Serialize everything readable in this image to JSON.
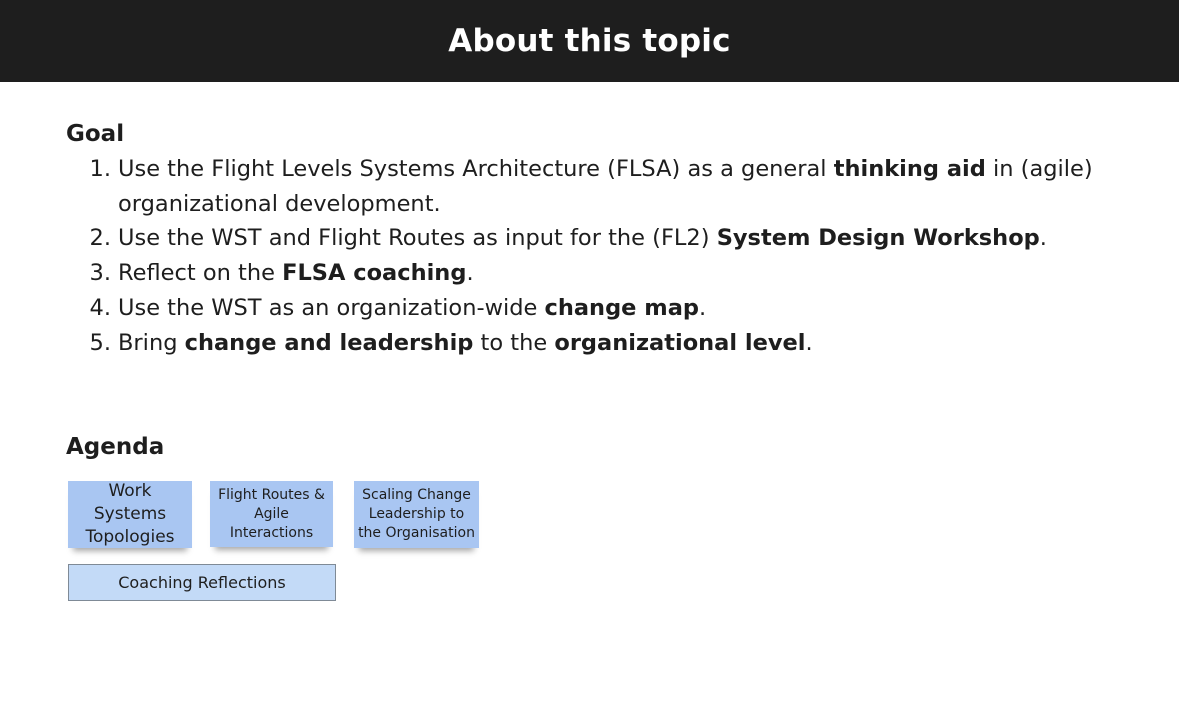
{
  "header": {
    "title": "About this topic"
  },
  "goal": {
    "heading": "Goal",
    "items": [
      {
        "number": "1.",
        "parts": [
          {
            "text": "Use the Flight Levels Systems Architecture (FLSA) as a general ",
            "bold": false
          },
          {
            "text": "thinking aid",
            "bold": true
          },
          {
            "text": " in (agile) organizational development.",
            "bold": false
          }
        ]
      },
      {
        "number": "2.",
        "parts": [
          {
            "text": "Use the WST and Flight Routes as input for the (FL2) ",
            "bold": false
          },
          {
            "text": "System Design Workshop",
            "bold": true
          },
          {
            "text": ".",
            "bold": false
          }
        ]
      },
      {
        "number": "3.",
        "parts": [
          {
            "text": "Reflect on the ",
            "bold": false
          },
          {
            "text": "FLSA coaching",
            "bold": true
          },
          {
            "text": ".",
            "bold": false
          }
        ]
      },
      {
        "number": "4.",
        "parts": [
          {
            "text": "Use the WST as an organization-wide ",
            "bold": false
          },
          {
            "text": "change map",
            "bold": true
          },
          {
            "text": ".",
            "bold": false
          }
        ]
      },
      {
        "number": "5.",
        "parts": [
          {
            "text": "Bring ",
            "bold": false
          },
          {
            "text": "change and leadership",
            "bold": true
          },
          {
            "text": " to the ",
            "bold": false
          },
          {
            "text": "organizational level",
            "bold": true
          },
          {
            "text": ".",
            "bold": false
          }
        ]
      }
    ]
  },
  "agenda": {
    "heading": "Agenda",
    "stickies": [
      {
        "lines": [
          "Work Systems",
          "Topologies"
        ]
      },
      {
        "lines": [
          "Flight Routes &",
          "Agile",
          "Interactions"
        ]
      },
      {
        "lines": [
          "Scaling Change",
          "Leadership to",
          "the Organisation"
        ]
      }
    ],
    "bar_label": "Coaching Reflections"
  },
  "colors": {
    "header_bg": "#1e1e1e",
    "sticky_bg": "#a9c6f2",
    "bar_bg": "#c3daf7"
  }
}
